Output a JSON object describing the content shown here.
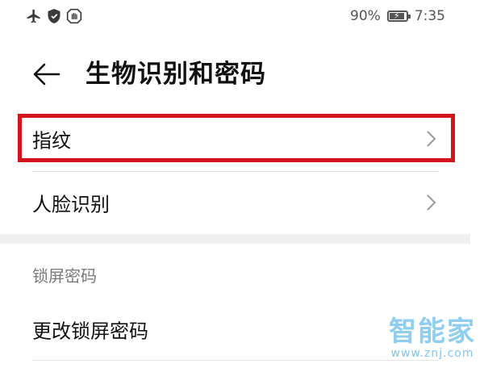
{
  "status_bar": {
    "icons_left": [
      "airplane-icon",
      "shield-icon",
      "hand-icon"
    ],
    "battery_percent": "90%",
    "battery_level": 0.9,
    "time": "7:35"
  },
  "header": {
    "back_icon": "arrow-left-icon",
    "title": "生物识别和密码"
  },
  "rows": [
    {
      "label": "指纹",
      "highlighted": true
    },
    {
      "label": "人脸识别",
      "highlighted": false
    }
  ],
  "section": {
    "title": "锁屏密码",
    "items": [
      {
        "label": "更改锁屏密码"
      }
    ]
  },
  "highlight_color": "#d4141c",
  "watermark": {
    "logo_text": "智能家",
    "url": "www.znj.com"
  }
}
